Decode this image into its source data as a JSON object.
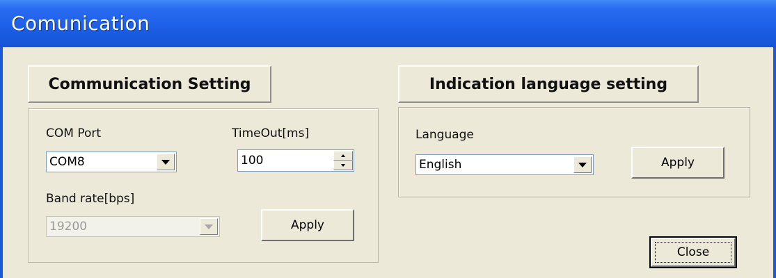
{
  "window": {
    "title": "Comunication"
  },
  "communication": {
    "header": "Communication Setting",
    "com_port_label": "COM Port",
    "com_port_value": "COM8",
    "timeout_label": "TimeOut[ms]",
    "timeout_value": "100",
    "baud_label": "Band rate[bps]",
    "baud_value": "19200",
    "apply_label": "Apply"
  },
  "language": {
    "header": "Indication language setting",
    "label": "Language",
    "value": "English",
    "apply_label": "Apply"
  },
  "footer": {
    "close_label": "Close"
  },
  "colors": {
    "titlebar": "#1d5fe6",
    "face": "#ece9d8",
    "field_border": "#7f9db9"
  },
  "icons": [
    "chevron-down-icon",
    "spin-up-icon",
    "spin-down-icon"
  ]
}
